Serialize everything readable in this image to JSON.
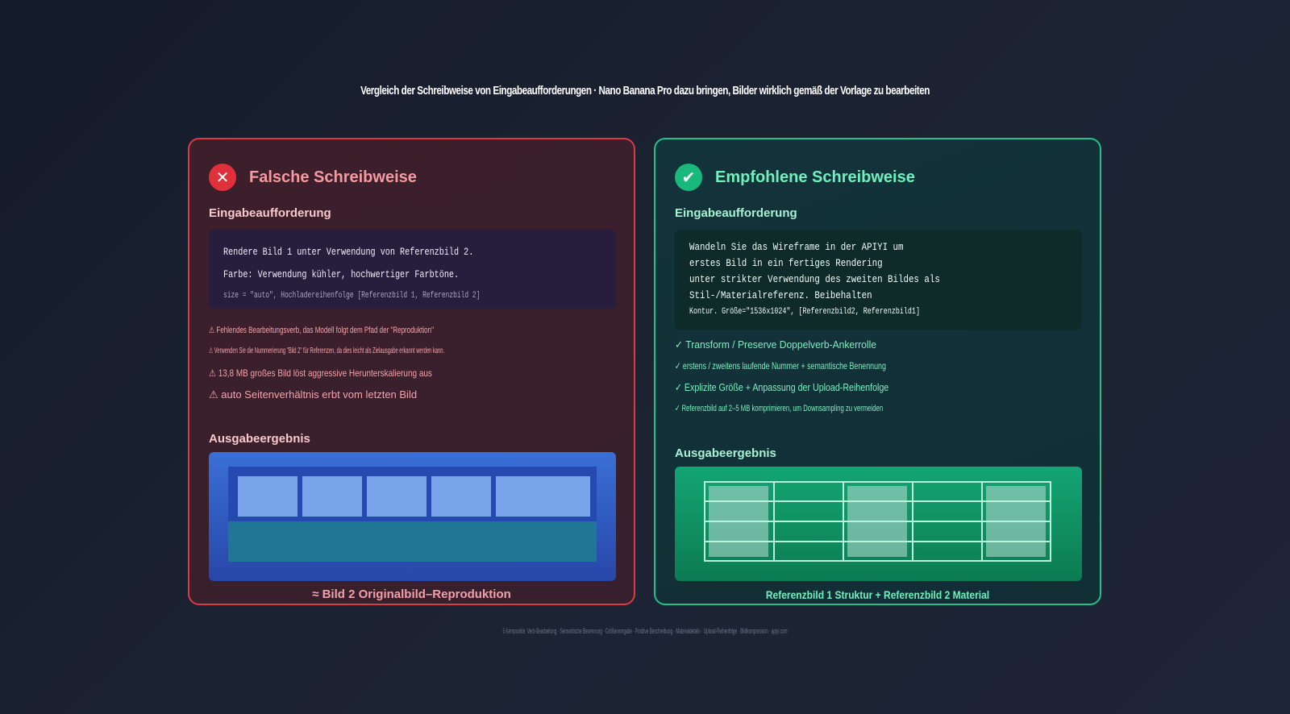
{
  "title": "Vergleich der Schreibweise von Eingabeaufforderungen · Nano Banana Pro dazu bringen, Bilder wirklich gemäß der Vorlage zu bearbeiten",
  "wrong": {
    "icon": "x-icon",
    "heading": "Falsche Schreibweise",
    "prompt_label": "Eingabeaufforderung",
    "prompt_lines": [
      "Rendere Bild 1 unter Verwendung von Referenzbild 2.",
      "Farbe: Verwendung kühler, hochwertiger Farbtöne.",
      "size = \"auto\", Hochladereihenfolge [Referenzbild 1, Referenzbild 2]"
    ],
    "warnings": [
      "⚠ Fehlendes Bearbeitungsverb, das Modell folgt dem Pfad der \"Reproduktion\"",
      "⚠ Verwenden Sie die Nummerierung \"Bild 2\" für Referenzen, da dies leicht als Zielausgabe erkannt werden kann.",
      "⚠ 13,8 MB großes Bild löst aggressive Herunterskalierung aus",
      "⚠ auto Seitenverhältnis erbt vom letzten Bild"
    ],
    "output_label": "Ausgabeergebnis",
    "caption": "≈ Bild 2 Originalbild–Reproduktion",
    "accent": "#d93a45"
  },
  "recommended": {
    "icon": "check-icon",
    "heading": "Empfohlene Schreibweise",
    "prompt_label": "Eingabeaufforderung",
    "prompt_lines": [
      "Wandeln Sie das Wireframe in der APIYI um",
      "erstes Bild in ein fertiges Rendering",
      "unter strikter Verwendung des zweiten Bildes als",
      "Stil-/Materialreferenz. Beibehalten",
      "Kontur. Größe=\"1536x1024\", [Referenzbild2, Referenzbild1]"
    ],
    "tips": [
      "✓ Transform / Preserve Doppelverb-Ankerrolle",
      "✓ erstens / zweitens laufende Nummer + semantische Benennung",
      "✓ Explizite Größe + Anpassung der Upload-Reihenfolge",
      "✓ Referenzbild auf 2–5 MB komprimieren, um Downsampling zu vermeiden"
    ],
    "output_label": "Ausgabeergebnis",
    "caption": "Referenzbild 1 Struktur + Referenzbild 2 Material",
    "accent": "#23c08a"
  },
  "footer": "5 Kernpunkte: Verb-Bearbeitung · Semantische Benennung · Größenvorgabe · Positive Beschreibung · Materialdetails · Upload-Reihenfolge · Bildkompression · apiyi.com"
}
